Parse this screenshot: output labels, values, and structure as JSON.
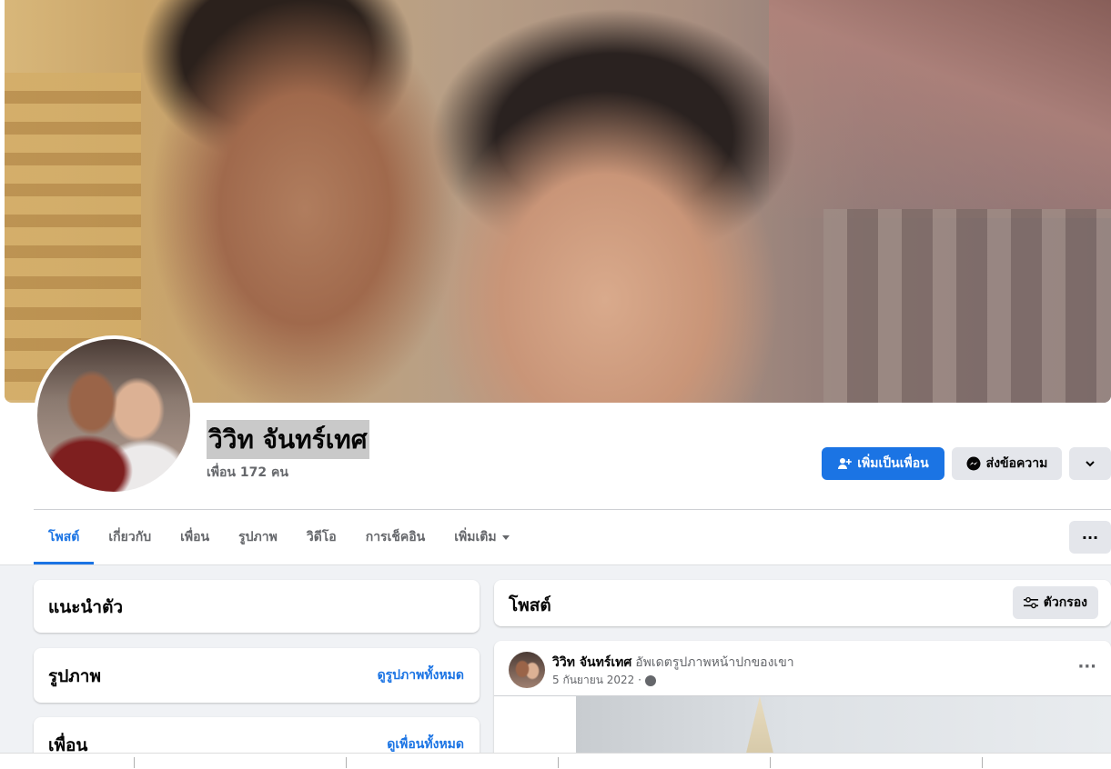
{
  "profile": {
    "name": "วิวิท จันทร์เทศ",
    "friends_count": "เพื่อน 172 คน"
  },
  "actions": {
    "add_friend": "เพิ่มเป็นเพื่อน",
    "message": "ส่งข้อความ"
  },
  "tabs": [
    {
      "label": "โพสต์",
      "active": true
    },
    {
      "label": "เกี่ยวกับ"
    },
    {
      "label": "เพื่อน"
    },
    {
      "label": "รูปภาพ"
    },
    {
      "label": "วิดีโอ"
    },
    {
      "label": "การเช็คอิน"
    },
    {
      "label": "เพิ่มเติม"
    }
  ],
  "sidebar": {
    "intro_title": "แนะนำตัว",
    "photos_title": "รูปภาพ",
    "photos_link": "ดูรูปภาพทั้งหมด",
    "friends_title": "เพื่อน",
    "friends_link": "ดูเพื่อนทั้งหมด"
  },
  "posts": {
    "title": "โพสต์",
    "filter_label": "ตัวกรอง",
    "items": [
      {
        "author": "วิวิท จันทร์เทศ",
        "action": "อัพเดตรูปภาพหน้าปกของเขา",
        "time": "5 กันยายน 2022 ·"
      }
    ]
  },
  "colors": {
    "accent": "#1b74e4",
    "secondary_button": "#e4e6eb",
    "feed_background": "#f0f2f5",
    "muted_text": "#65676b"
  },
  "icons": {
    "add_friend": "person-plus-icon",
    "message": "messenger-icon",
    "more": "chevron-down-icon",
    "tab_more": "ellipsis-icon",
    "filter": "sliders-icon",
    "privacy": "globe-icon"
  }
}
